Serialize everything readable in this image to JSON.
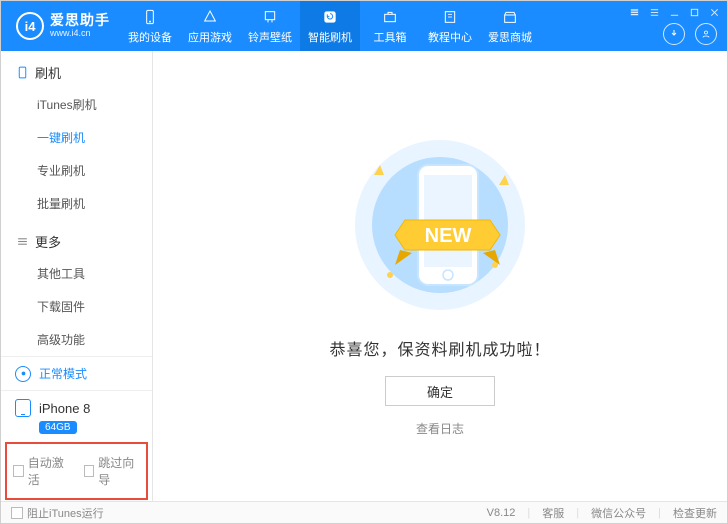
{
  "brand": {
    "badge": "i4",
    "title": "爱思助手",
    "subtitle": "www.i4.cn"
  },
  "nav": {
    "items": [
      {
        "label": "我的设备",
        "icon": "phone"
      },
      {
        "label": "应用游戏",
        "icon": "app"
      },
      {
        "label": "铃声壁纸",
        "icon": "note"
      },
      {
        "label": "智能刷机",
        "icon": "refresh",
        "active": true
      },
      {
        "label": "工具箱",
        "icon": "toolbox"
      },
      {
        "label": "教程中心",
        "icon": "book"
      },
      {
        "label": "爱思商城",
        "icon": "shop"
      }
    ]
  },
  "sidebar": {
    "groups": [
      {
        "title": "刷机",
        "icon": "phone-outline",
        "items": [
          "iTunes刷机",
          "一键刷机",
          "专业刷机",
          "批量刷机"
        ],
        "activeIndex": 1
      },
      {
        "title": "更多",
        "icon": "menu",
        "items": [
          "其他工具",
          "下载固件",
          "高级功能"
        ],
        "activeIndex": -1
      }
    ],
    "mode": {
      "label": "正常模式"
    },
    "device": {
      "name": "iPhone 8",
      "storage": "64GB"
    },
    "checks": {
      "autoActivate": "自动激活",
      "skipGuide": "跳过向导"
    }
  },
  "main": {
    "newBadge": "NEW",
    "successText": "恭喜您，保资料刷机成功啦！",
    "okButton": "确定",
    "viewLog": "查看日志"
  },
  "statusbar": {
    "blockItunes": "阻止iTunes运行",
    "version": "V8.12",
    "support": "客服",
    "wechat": "微信公众号",
    "checkUpdate": "检查更新"
  }
}
